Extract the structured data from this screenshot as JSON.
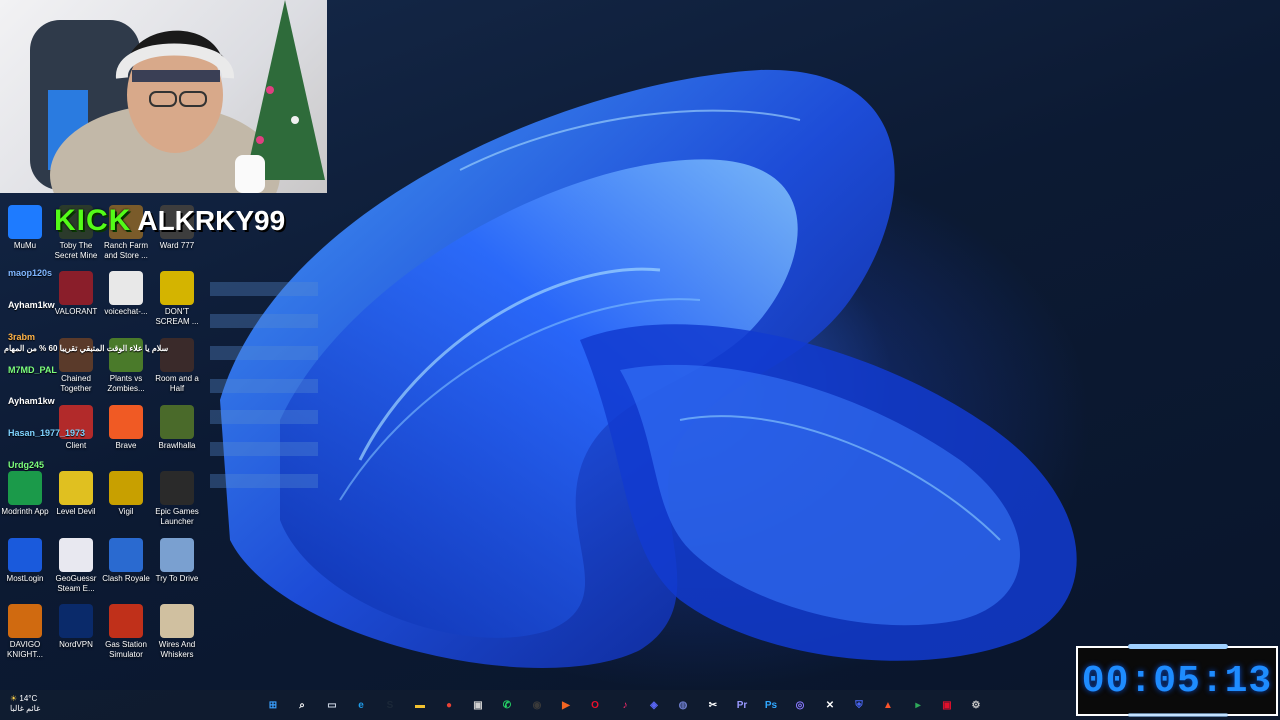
{
  "overlay": {
    "kick_logo": "KICK",
    "streamer_name": "ALKRKY99",
    "timer": "00:05:13"
  },
  "desktop": {
    "icons": [
      {
        "label": "MuMu",
        "icon": "mumu-icon",
        "color": "#1e7bff"
      },
      {
        "label": "Toby The Secret Mine",
        "icon": "toby-icon",
        "color": "#2b3a2b"
      },
      {
        "label": "Ranch Farm and Store ...",
        "icon": "ranch-icon",
        "color": "#7a5b2a"
      },
      {
        "label": "Ward 777",
        "icon": "ward-icon",
        "color": "#3d3d3d"
      },
      {
        "label": "VALORANT",
        "icon": "valorant-icon",
        "color": "#8a1e2a"
      },
      {
        "label": "voicechat-...",
        "icon": "java-icon",
        "color": "#e8e8e8"
      },
      {
        "label": "DON'T SCREAM ...",
        "icon": "dont-scream-icon",
        "color": "#d4b400"
      },
      {
        "label": "Chained Together",
        "icon": "chained-icon",
        "color": "#5a3a2a"
      },
      {
        "label": "Plants vs Zombies...",
        "icon": "pvz-icon",
        "color": "#4a7a2a"
      },
      {
        "label": "Room and a Half",
        "icon": "room-icon",
        "color": "#3a2a2a"
      },
      {
        "label": "Client",
        "icon": "client-icon",
        "color": "#b22a2a"
      },
      {
        "label": "Brave",
        "icon": "brave-icon",
        "color": "#f05a24"
      },
      {
        "label": "Brawlhalla",
        "icon": "brawlhalla-icon",
        "color": "#4a6a2a"
      },
      {
        "label": "Modrinth App",
        "icon": "modrinth-icon",
        "color": "#1b9a4a"
      },
      {
        "label": "Level Devil",
        "icon": "level-devil-icon",
        "color": "#e0c020"
      },
      {
        "label": "Vigil",
        "icon": "vigil-icon",
        "color": "#c8a000"
      },
      {
        "label": "Epic Games Launcher",
        "icon": "epic-games-icon",
        "color": "#2a2a2a"
      },
      {
        "label": "MostLogin",
        "icon": "mostlogin-icon",
        "color": "#1a5adc"
      },
      {
        "label": "GeoGuessr Steam E...",
        "icon": "geoguessr-icon",
        "color": "#e8e8f0"
      },
      {
        "label": "Clash Royale",
        "icon": "clash-royale-icon",
        "color": "#2a6ad0"
      },
      {
        "label": "Try To Drive",
        "icon": "try-to-drive-icon",
        "color": "#7aa0d0"
      },
      {
        "label": "DAVIGO KNIGHT...",
        "icon": "davigo-icon",
        "color": "#d06a10"
      },
      {
        "label": "NordVPN",
        "icon": "nordvpn-icon",
        "color": "#0a2a6a"
      },
      {
        "label": "Gas Station Simulator",
        "icon": "gas-station-icon",
        "color": "#c0301a"
      },
      {
        "label": "Wires And Whiskers",
        "icon": "wires-icon",
        "color": "#d0c0a0"
      }
    ]
  },
  "chat": [
    {
      "user": "maop120s",
      "color": "#7fb6ff",
      "msg": ""
    },
    {
      "user": "Ayham1kw",
      "color": "#ffffff",
      "msg": ""
    },
    {
      "user": "3rabm",
      "color": "#ffb347",
      "msg": "سلام يا علاء الوقت المتبقي تقريبا 60 % من المهام"
    },
    {
      "user": "M7MD_PAL",
      "color": "#7dff7d",
      "msg": ""
    },
    {
      "user": "Ayham1kw",
      "color": "#ffffff",
      "msg": ""
    },
    {
      "user": "Hasan_1977_1973",
      "color": "#7fd3ff",
      "msg": ""
    },
    {
      "user": "Urdg245",
      "color": "#7dff7d",
      "msg": ""
    }
  ],
  "taskbar": {
    "weather_temp": "14°C",
    "weather_desc": "غائم غالبا",
    "icons": [
      "windows-start-icon",
      "search-icon",
      "task-view-icon",
      "edge-icon",
      "steam-icon",
      "file-explorer-icon",
      "chrome-icon",
      "app-icon",
      "whatsapp-icon",
      "obs-icon",
      "ea-icon",
      "opera-icon",
      "tiktok-icon",
      "discord-icon",
      "app2-icon",
      "capcut-icon",
      "premiere-icon",
      "photoshop-icon",
      "controller-icon",
      "capcut2-icon",
      "vpn-icon",
      "brave-icon",
      "app3-icon",
      "app4-icon",
      "settings-icon"
    ]
  }
}
